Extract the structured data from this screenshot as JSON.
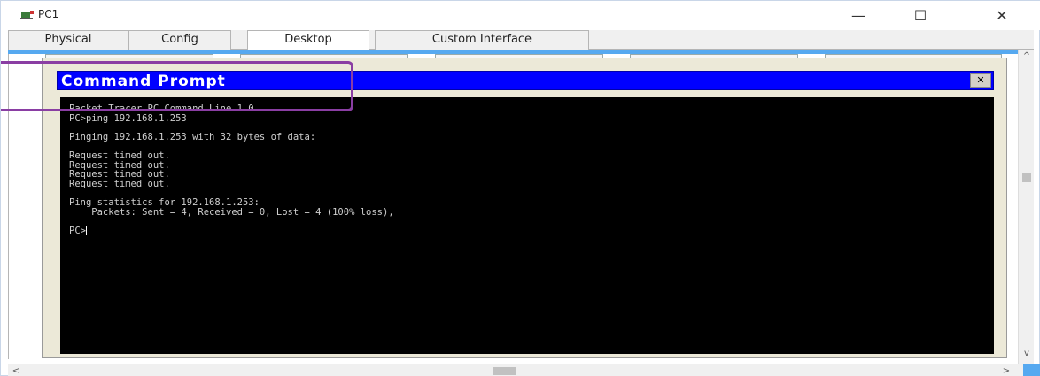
{
  "window": {
    "title": "PC1",
    "minimize_glyph": "—",
    "maximize_glyph": "☐",
    "close_glyph": "✕"
  },
  "tabs": [
    {
      "label": "Physical",
      "active": false
    },
    {
      "label": "Config",
      "active": false
    },
    {
      "label": "Desktop",
      "active": true
    },
    {
      "label": "Custom Interface",
      "active": false
    }
  ],
  "command_prompt": {
    "title": "Command Prompt",
    "close_glyph": "✕",
    "lines": [
      "Packet Tracer PC Command Line 1.0",
      "PC>ping 192.168.1.253",
      "",
      "Pinging 192.168.1.253 with 32 bytes of data:",
      "",
      "Request timed out.",
      "Request timed out.",
      "Request timed out.",
      "Request timed out.",
      "",
      "Ping statistics for 192.168.1.253:",
      "    Packets: Sent = 4, Received = 0, Lost = 4 (100% loss),",
      "",
      "PC>"
    ]
  },
  "scrollbars": {
    "up_glyph": "^",
    "down_glyph": "v",
    "left_glyph": "<",
    "right_glyph": ">"
  },
  "colors": {
    "cmd_titlebar": "#0000ff",
    "terminal_bg": "#000000",
    "terminal_fg": "#cfcfcf",
    "highlight": "#8a3ea3",
    "accent": "#56a9f0"
  }
}
